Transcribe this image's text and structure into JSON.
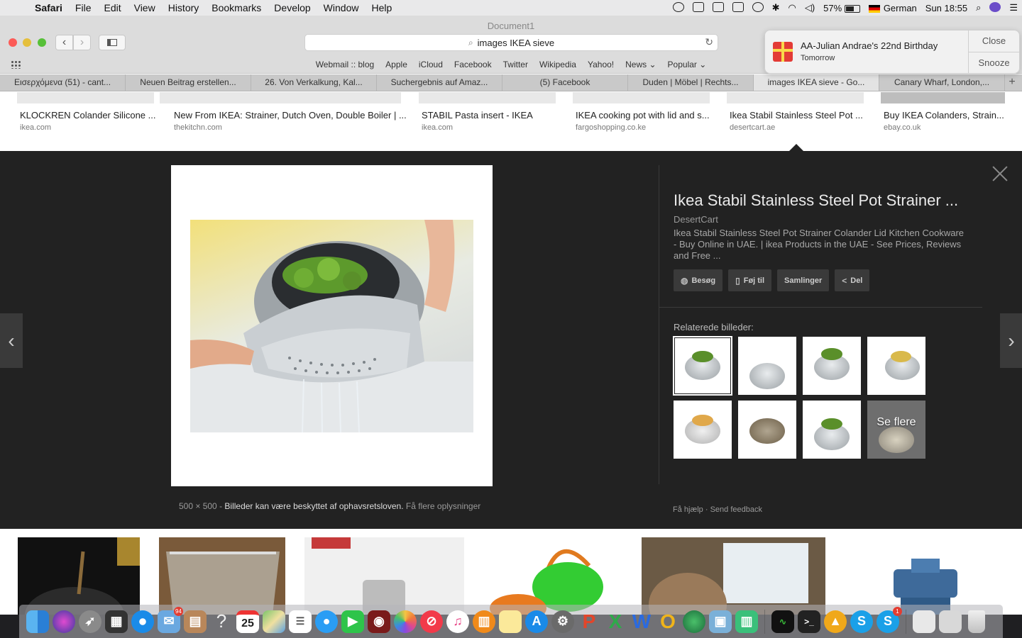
{
  "menubar": {
    "app": "Safari",
    "items": [
      "File",
      "Edit",
      "View",
      "History",
      "Bookmarks",
      "Develop",
      "Window",
      "Help"
    ],
    "battery": "57%",
    "input_source": "German",
    "clock": "Sun 18:55"
  },
  "window": {
    "title": "Document1",
    "address": "images  IKEA sieve"
  },
  "bookmarks": [
    "Webmail :: blog",
    "Apple",
    "iCloud",
    "Facebook",
    "Twitter",
    "Wikipedia",
    "Yahoo!",
    "News ⌄",
    "Popular ⌄"
  ],
  "tabs": [
    {
      "label": "Εισερχόμενα (51) - cant...",
      "active": false
    },
    {
      "label": "Neuen Beitrag erstellen...",
      "active": false
    },
    {
      "label": "26. Von Verkalkung, Kal...",
      "active": false
    },
    {
      "label": "Suchergebnis auf Amaz...",
      "active": false
    },
    {
      "label": "(5) Facebook",
      "active": false
    },
    {
      "label": "Duden | Möbel | Rechts...",
      "active": false
    },
    {
      "label": "images IKEA sieve - Go...",
      "active": true
    },
    {
      "label": "Canary Wharf, London,...",
      "active": false
    }
  ],
  "notification": {
    "title": "AA-Julian Andrae's 22nd Birthday",
    "subtitle": "Tomorrow",
    "close": "Close",
    "snooze": "Snooze"
  },
  "top_results": [
    {
      "title": "KLOCKREN Colander Silicone ...",
      "source": "ikea.com"
    },
    {
      "title": "New From IKEA: Strainer, Dutch Oven, Double Boiler | ...",
      "source": "thekitchn.com"
    },
    {
      "title": "STABIL Pasta insert - IKEA",
      "source": "ikea.com"
    },
    {
      "title": "IKEA cooking pot with lid and s...",
      "source": "fargoshopping.co.ke"
    },
    {
      "title": "Ikea Stabil Stainless Steel Pot ...",
      "source": "desertcart.ae"
    },
    {
      "title": "Buy IKEA Colanders, Strain...",
      "source": "ebay.co.uk"
    }
  ],
  "viewer": {
    "dimensions": "500 × 500",
    "copyright": "Billeder kan være beskyttet af ophavsretsloven.",
    "more_info": "Få flere oplysninger",
    "title": "Ikea Stabil Stainless Steel Pot Strainer ...",
    "source": "DesertCart",
    "description": "Ikea Stabil Stainless Steel Pot Strainer Colander Lid Kitchen Cookware - Buy Online in UAE. | ikea Products in the UAE - See Prices, Reviews and Free ...",
    "buttons": {
      "visit": "Besøg",
      "save": "Føj til",
      "collections": "Samlinger",
      "share": "Del"
    },
    "related_label": "Relaterede billeder:",
    "see_more": "Se flere",
    "help": "Få hjælp",
    "feedback": "Send feedback"
  },
  "dock": {
    "mail_badge": "94",
    "calendar_day": "25",
    "skype_badge": "1"
  },
  "colors": {
    "viewer_bg": "#222222",
    "button_bg": "#3a3a3a",
    "active_tab": "#e3e3e3"
  }
}
